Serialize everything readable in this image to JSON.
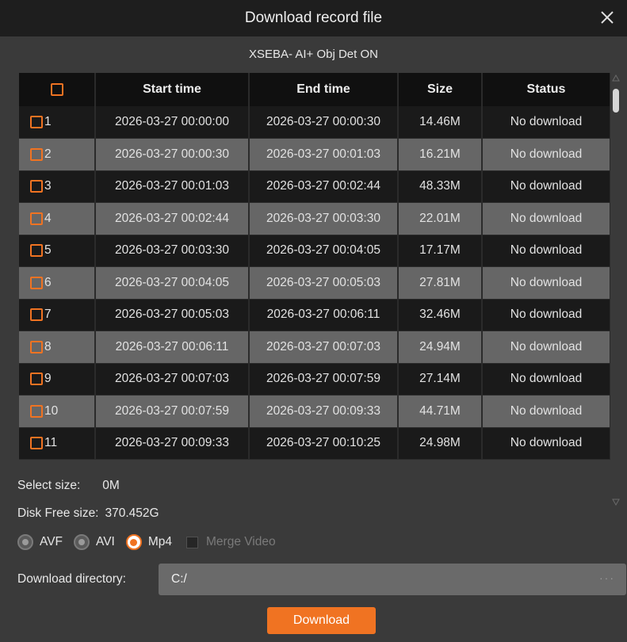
{
  "window": {
    "title": "Download record file",
    "close_icon": "close-icon"
  },
  "device": {
    "name": "XSEBA- AI+ Obj Det ON"
  },
  "table": {
    "columns": [
      "Start time",
      "End time",
      "Size",
      "Status"
    ],
    "rows": [
      {
        "index": "1",
        "start": "2026-03-27 00:00:00",
        "end": "2026-03-27 00:00:30",
        "size": "14.46M",
        "status": "No download"
      },
      {
        "index": "2",
        "start": "2026-03-27 00:00:30",
        "end": "2026-03-27 00:01:03",
        "size": "16.21M",
        "status": "No download"
      },
      {
        "index": "3",
        "start": "2026-03-27 00:01:03",
        "end": "2026-03-27 00:02:44",
        "size": "48.33M",
        "status": "No download"
      },
      {
        "index": "4",
        "start": "2026-03-27 00:02:44",
        "end": "2026-03-27 00:03:30",
        "size": "22.01M",
        "status": "No download"
      },
      {
        "index": "5",
        "start": "2026-03-27 00:03:30",
        "end": "2026-03-27 00:04:05",
        "size": "17.17M",
        "status": "No download"
      },
      {
        "index": "6",
        "start": "2026-03-27 00:04:05",
        "end": "2026-03-27 00:05:03",
        "size": "27.81M",
        "status": "No download"
      },
      {
        "index": "7",
        "start": "2026-03-27 00:05:03",
        "end": "2026-03-27 00:06:11",
        "size": "32.46M",
        "status": "No download"
      },
      {
        "index": "8",
        "start": "2026-03-27 00:06:11",
        "end": "2026-03-27 00:07:03",
        "size": "24.94M",
        "status": "No download"
      },
      {
        "index": "9",
        "start": "2026-03-27 00:07:03",
        "end": "2026-03-27 00:07:59",
        "size": "27.14M",
        "status": "No download"
      },
      {
        "index": "10",
        "start": "2026-03-27 00:07:59",
        "end": "2026-03-27 00:09:33",
        "size": "44.71M",
        "status": "No download"
      },
      {
        "index": "11",
        "start": "2026-03-27 00:09:33",
        "end": "2026-03-27 00:10:25",
        "size": "24.98M",
        "status": "No download"
      }
    ]
  },
  "summary": {
    "select_size_label": "Select size:",
    "select_size_value": "0M",
    "disk_free_label": "Disk Free size:",
    "disk_free_value": "370.452G"
  },
  "formats": {
    "options": [
      "AVF",
      "AVI",
      "Mp4"
    ],
    "selected": "Mp4",
    "merge_label": "Merge Video"
  },
  "directory": {
    "label": "Download directory:",
    "value": "C:/",
    "more": "···"
  },
  "actions": {
    "download_label": "Download"
  },
  "colors": {
    "accent": "#f07322",
    "row_dark": "#1a1a1a",
    "row_light": "#666666",
    "titlebar": "#1e1e1e"
  }
}
